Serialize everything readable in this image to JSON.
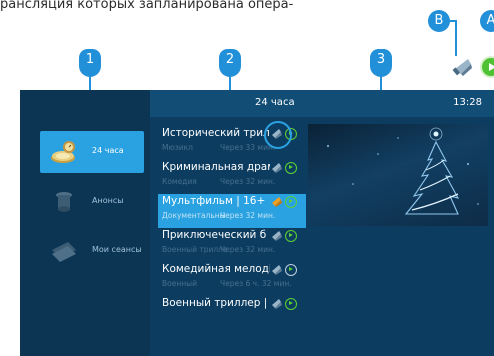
{
  "caption_fragment": "рансляция которых запланирована опера-",
  "markers": {
    "m1": "1",
    "m2": "2",
    "m3": "3",
    "mB": "B",
    "mA": "A"
  },
  "header": {
    "title": "24 часа",
    "time": "13:28"
  },
  "sidebar": {
    "items": [
      {
        "label": "24 часа",
        "icon": "stopwatch-icon",
        "active": true
      },
      {
        "label": "Анонсы",
        "icon": "trashbin-icon",
        "active": false
      },
      {
        "label": "Мои сеансы",
        "icon": "ticket-stack-icon",
        "active": false
      }
    ]
  },
  "programs": [
    {
      "title": "Исторический трил",
      "genre": "Мюзикл",
      "time": "Через 33 мин.",
      "selected": false
    },
    {
      "title": "Криминальная драм",
      "genre": "Комедия",
      "time": "Через 32 мин.",
      "selected": false
    },
    {
      "title": "Мультфильм | 16+",
      "genre": "Документальны",
      "time": "Через 32 мин.",
      "selected": true
    },
    {
      "title": "Приключеческий б",
      "genre": "Военный трилле",
      "time": "Через 32 мин.",
      "selected": false
    },
    {
      "title": "Комедийная мелоді",
      "genre": "Военный",
      "time": "Через 6 ч. 32 мин.",
      "selected": false
    },
    {
      "title": "Военный триллер | 1",
      "genre": "",
      "time": "",
      "selected": false
    }
  ],
  "colors": {
    "accent": "#2aa2e2",
    "marker": "#2190d8",
    "play": "#5cd032",
    "record": "#f0a020",
    "background": "#0c3d61"
  }
}
